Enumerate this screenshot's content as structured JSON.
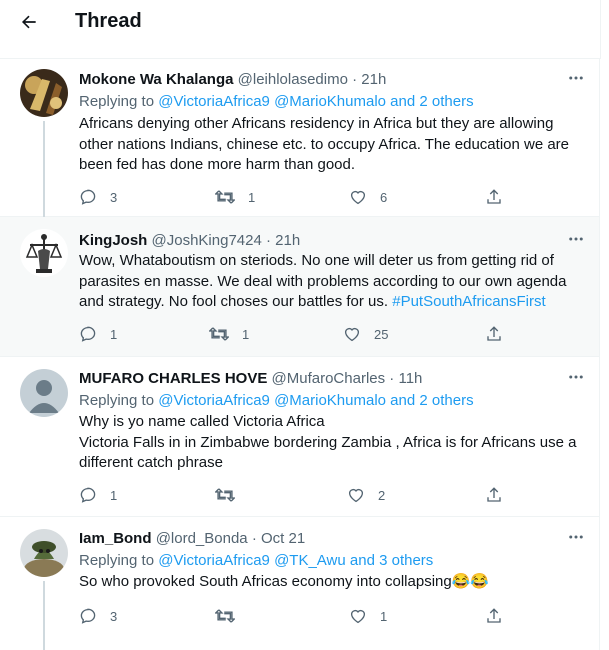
{
  "header": {
    "title": "Thread"
  },
  "replying_prefix": "Replying to",
  "tweets": [
    {
      "name": "Mokone Wa Khalanga",
      "handle": "@leihlolasedimo",
      "sep": "·",
      "time": "21h",
      "replying": {
        "m1": "@VictoriaAfrica9",
        "m2": "@MarioKhumalo",
        "and": "and",
        "others": "2 others"
      },
      "text_lines": [
        "Africans denying other Africans residency in Africa but they are allowing",
        "other nations Indians, chinese etc. to occupy Africa. The education we are",
        "been fed has done more harm than good."
      ],
      "replies": "3",
      "retweets": "1",
      "likes": "6"
    },
    {
      "name": "KingJosh",
      "handle": "@JoshKing7424",
      "sep": "·",
      "time": "21h",
      "text_lines": [
        "Wow, Whataboutism on steriods. No one will deter us from getting rid of",
        "parasites en masse. We deal with problems according to our own agenda",
        "and strategy. No fool choses our battles for us. "
      ],
      "hashtag": "#PutSouthAfricansFirst",
      "replies": "1",
      "retweets": "1",
      "likes": "25"
    },
    {
      "name": "MUFARO CHARLES HOVE",
      "handle": "@MufaroCharles",
      "sep": "·",
      "time": "11h",
      "replying": {
        "m1": "@VictoriaAfrica9",
        "m2": "@MarioKhumalo",
        "and": "and",
        "others": "2 others"
      },
      "text_lines": [
        "Why is yo name called Victoria Africa",
        "Victoria Falls  in in Zimbabwe bordering Zambia , Africa is for Africans use a",
        "different catch phrase"
      ],
      "replies": "1",
      "retweets": "",
      "likes": "2"
    },
    {
      "name": "Iam_Bond",
      "handle": "@lord_Bonda",
      "sep": "·",
      "time": "Oct 21",
      "replying": {
        "m1": "@VictoriaAfrica9",
        "m2": "@TK_Awu",
        "and": "and",
        "others": "3 others"
      },
      "text_lines": [
        "So who provoked South Africas economy into collapsing😂😂"
      ],
      "replies": "3",
      "retweets": "",
      "likes": "1"
    }
  ],
  "icons": {
    "back": "arrow-left-icon",
    "more": "more-horizontal-icon",
    "reply": "reply-icon",
    "retweet": "retweet-icon",
    "like": "heart-icon",
    "share": "share-icon"
  },
  "colors": {
    "accent": "#1d9bf0",
    "secondary_text": "#536471",
    "highlight_bg": "#f7f9f9"
  }
}
